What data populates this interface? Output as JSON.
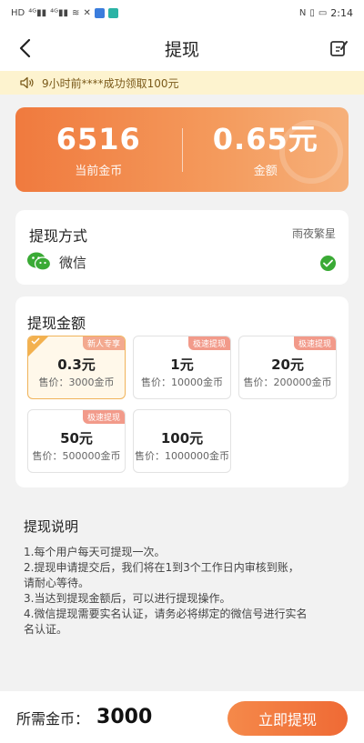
{
  "status": {
    "left_icons": [
      "HD",
      "4G",
      "4G",
      "wifi",
      "x",
      "app-blue",
      "app-green"
    ],
    "time": "2:14"
  },
  "nav": {
    "title": "提现"
  },
  "notice": {
    "text": "9小时前****成功领取100元"
  },
  "coins": {
    "current_value": "6516",
    "current_label": "当前金币",
    "amount_value": "0.65元",
    "amount_label": "金额"
  },
  "method": {
    "title": "提现方式",
    "user": "雨夜繁星",
    "name": "微信"
  },
  "amount": {
    "title": "提现金额",
    "options": [
      {
        "amount": "0.3元",
        "price": "售价：3000金币",
        "badge": "新人专享",
        "selected": true
      },
      {
        "amount": "1元",
        "price": "售价：10000金币",
        "badge": "极速提现",
        "selected": false
      },
      {
        "amount": "20元",
        "price": "售价：200000金币",
        "badge": "极速提现",
        "selected": false
      },
      {
        "amount": "50元",
        "price": "售价：500000金币",
        "badge": "极速提现",
        "selected": false
      },
      {
        "amount": "100元",
        "price": "售价：1000000金币",
        "badge": "",
        "selected": false
      }
    ]
  },
  "description": {
    "title": "提现说明",
    "lines": [
      "1.每个用户每天可提现一次。",
      "2.提现申请提交后，我们将在1到3个工作日内审核到账，",
      "请耐心等待。",
      "3.当达到提现金额后，可以进行提现操作。",
      "4.微信提现需要实名认证，请务必将绑定的微信号进行实名",
      "名认证。"
    ]
  },
  "bottom": {
    "need_label": "所需金币：",
    "need_value": "3000",
    "submit_label": "立即提现"
  },
  "colors": {
    "accent": "#ef6a35",
    "card_gradient_start": "#f07a3e",
    "selected_border": "#f0b35a",
    "check_green": "#3aaa35"
  }
}
